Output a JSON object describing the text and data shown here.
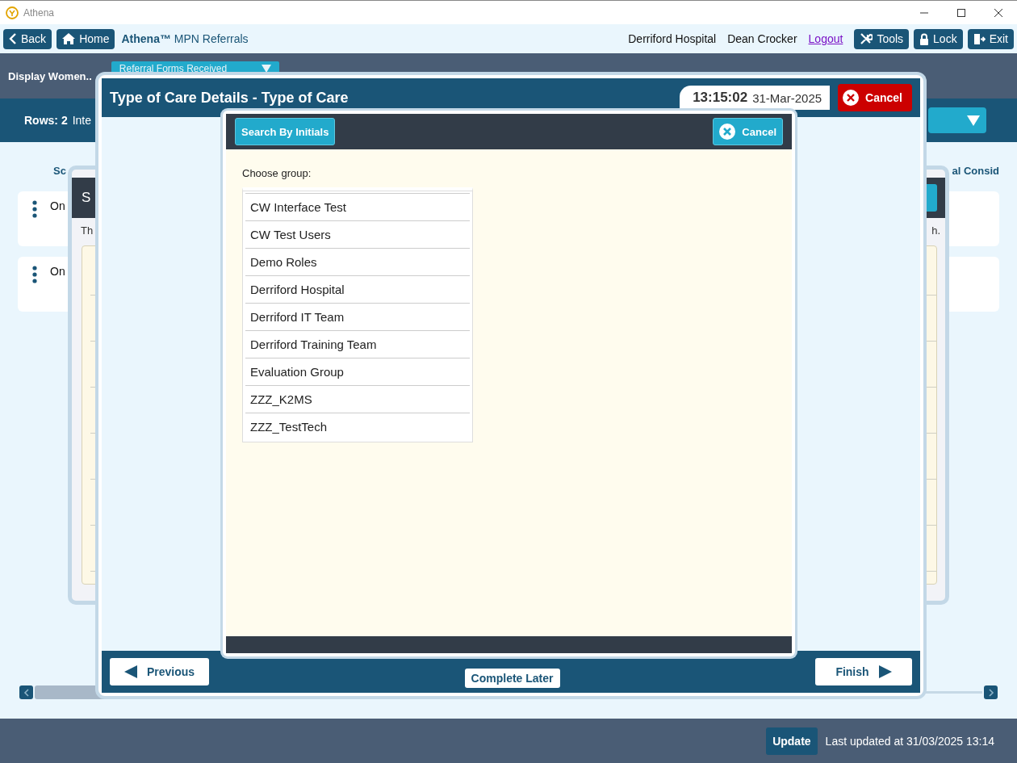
{
  "window": {
    "title": "Athena"
  },
  "toolbar": {
    "back": "Back",
    "home": "Home",
    "app_title": "**Athena™** MPN Referrals",
    "hospital": "Derriford Hospital",
    "user": "Dean Crocker",
    "logout": "Logout",
    "tools": "Tools",
    "lock": "Lock",
    "exit": "Exit"
  },
  "filter_bar": {
    "label": "Display Women..",
    "dropdown": "Referral Forms Received"
  },
  "rows_bar": {
    "count_label": "Rows: 2",
    "text": "Inte"
  },
  "table": {
    "column_1": "Sc",
    "column_last": "al Consid",
    "rows": [
      {
        "cell": "On"
      },
      {
        "cell": "On"
      }
    ]
  },
  "background_dialog": {
    "title": "S",
    "text_start": "Th",
    "text_end": "h."
  },
  "care_dialog": {
    "title": "Type of Care Details - Type of Care",
    "time": "13:15:02",
    "date": "31-Mar-2025",
    "cancel": "Cancel",
    "previous": "Previous",
    "complete_later": "Complete Later",
    "finish": "Finish"
  },
  "group_dialog": {
    "search_button": "Search By Initials",
    "cancel": "Cancel",
    "prompt": "Choose group:",
    "groups": [
      {
        "label": "CW Interface Test",
        "selected": false
      },
      {
        "label": "CW Test Users",
        "selected": false
      },
      {
        "label": "Demo Roles",
        "selected": false
      },
      {
        "label": "Derriford Hospital",
        "selected": false
      },
      {
        "label": "Derriford IT Team",
        "selected": false
      },
      {
        "label": "Derriford Training Team",
        "selected": false
      },
      {
        "label": "Evaluation Group",
        "selected": false
      },
      {
        "label": "ZZZ_K2MS",
        "selected": false
      },
      {
        "label": "ZZZ_TestTech",
        "selected": false
      }
    ]
  },
  "status_bar": {
    "update": "Update",
    "last_updated": "Last updated at 31/03/2025 13:14"
  }
}
